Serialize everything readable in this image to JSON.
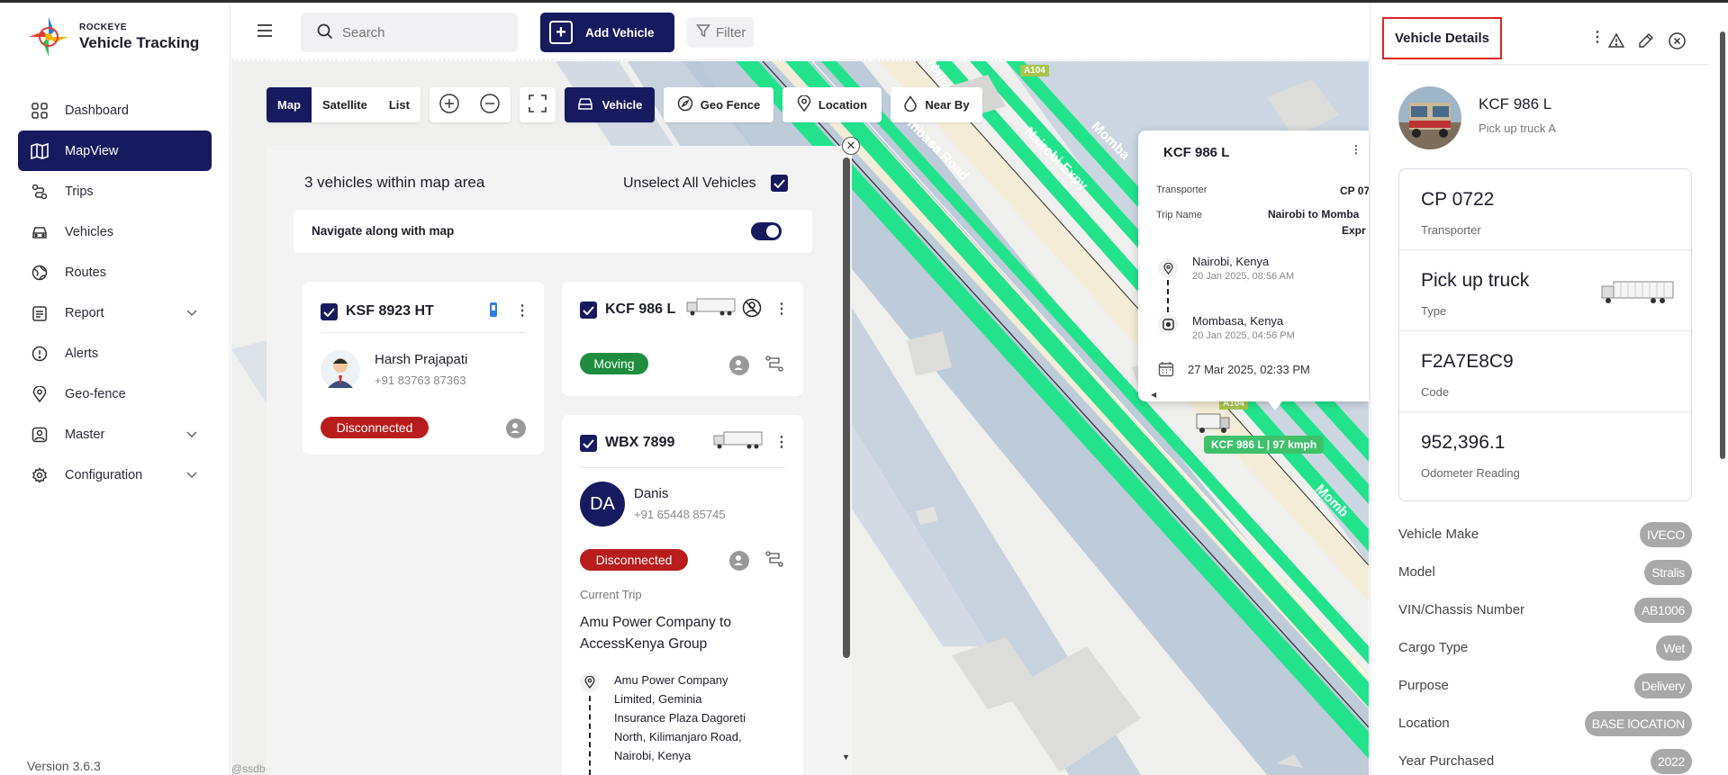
{
  "brand": {
    "small": "ROCKEYE",
    "big": "Vehicle Tracking"
  },
  "sidebar": {
    "items": [
      {
        "label": "Dashboard"
      },
      {
        "label": "MapView"
      },
      {
        "label": "Trips"
      },
      {
        "label": "Vehicles"
      },
      {
        "label": "Routes"
      },
      {
        "label": "Report"
      },
      {
        "label": "Alerts"
      },
      {
        "label": "Geo-fence"
      },
      {
        "label": "Master"
      },
      {
        "label": "Configuration"
      }
    ],
    "version": "Version 3.6.3"
  },
  "topbar": {
    "search_placeholder": "Search",
    "add_vehicle": "Add Vehicle",
    "filter": "Filter"
  },
  "map_toolbar": {
    "views": [
      "Map",
      "Satellite",
      "List"
    ],
    "vehicle": "Vehicle",
    "geofence": "Geo Fence",
    "location": "Location",
    "nearby": "Near By"
  },
  "map_labels": {
    "road_a104_top": "A104",
    "road_a104_mid": "A104",
    "nairobi_expy": "Nairobi Expy",
    "mombasa_road": "mbasa Road",
    "momba_top": "Momba",
    "momba_bottom": "Momb",
    "nairobi_top": "Nairobi E",
    "attribution": "@ssdb"
  },
  "panel": {
    "title": "3 vehicles within map area",
    "unselect": "Unselect All Vehicles",
    "navigate": "Navigate along with map",
    "vehicles": [
      {
        "plate": "KSF 8923 HT",
        "driver": "Harsh Prajapati",
        "phone": "+91 83763 87363",
        "status": "Disconnected"
      },
      {
        "plate": "KCF 986 L",
        "status": "Moving"
      },
      {
        "plate": "WBX 7899",
        "initials": "DA",
        "driver": "Danis",
        "phone": "+91 65448 85745",
        "status": "Disconnected",
        "trip_label": "Current Trip",
        "trip_name_1": "Amu Power Company to",
        "trip_name_2": "AccessKenya Group",
        "address_lines": [
          "Amu Power Company",
          "Limited, Geminia",
          "Insurance Plaza Dagoreti",
          "North, Kilimanjaro Road,",
          "Nairobi, Kenya"
        ]
      }
    ]
  },
  "popup": {
    "plate": "KCF 986 L",
    "transporter_label": "Transporter",
    "transporter_value": "CP 07",
    "trip_label": "Trip Name",
    "trip_value_1": "Nairobi to Momba",
    "trip_value_2": "Expr",
    "from_city": "Nairobi, Kenya",
    "from_time": "20 Jan 2025, 08:56 AM",
    "to_city": "Mombasa, Kenya",
    "to_time": "20 Jan 2025, 04:56 PM",
    "date": "27 Mar 2025, 02:33 PM",
    "speed_tag": "KCF 986 L | 97 kmph"
  },
  "details": {
    "title": "Vehicle Details",
    "plate": "KCF 986 L",
    "subtitle": "Pick up truck A",
    "info": [
      {
        "value": "CP 0722",
        "label": "Transporter"
      },
      {
        "value": "Pick up truck",
        "label": "Type"
      },
      {
        "value": "F2A7E8C9",
        "label": "Code"
      },
      {
        "value": "952,396.1",
        "label": "Odometer Reading"
      }
    ],
    "fields": [
      {
        "key": "Vehicle Make",
        "value": "IVECO"
      },
      {
        "key": "Model",
        "value": "Stralis"
      },
      {
        "key": "VIN/Chassis Number",
        "value": "AB1006"
      },
      {
        "key": "Cargo Type",
        "value": "Wet"
      },
      {
        "key": "Purpose",
        "value": "Delivery"
      },
      {
        "key": "Location",
        "value": "BASE lOCATION"
      },
      {
        "key": "Year Purchased",
        "value": "2022"
      }
    ]
  },
  "colors": {
    "primary": "#171a5e",
    "road_green": "#22e38c",
    "disconnected": "#b91c1c",
    "moving": "#1e8e3e",
    "highlight": "#e02424"
  }
}
